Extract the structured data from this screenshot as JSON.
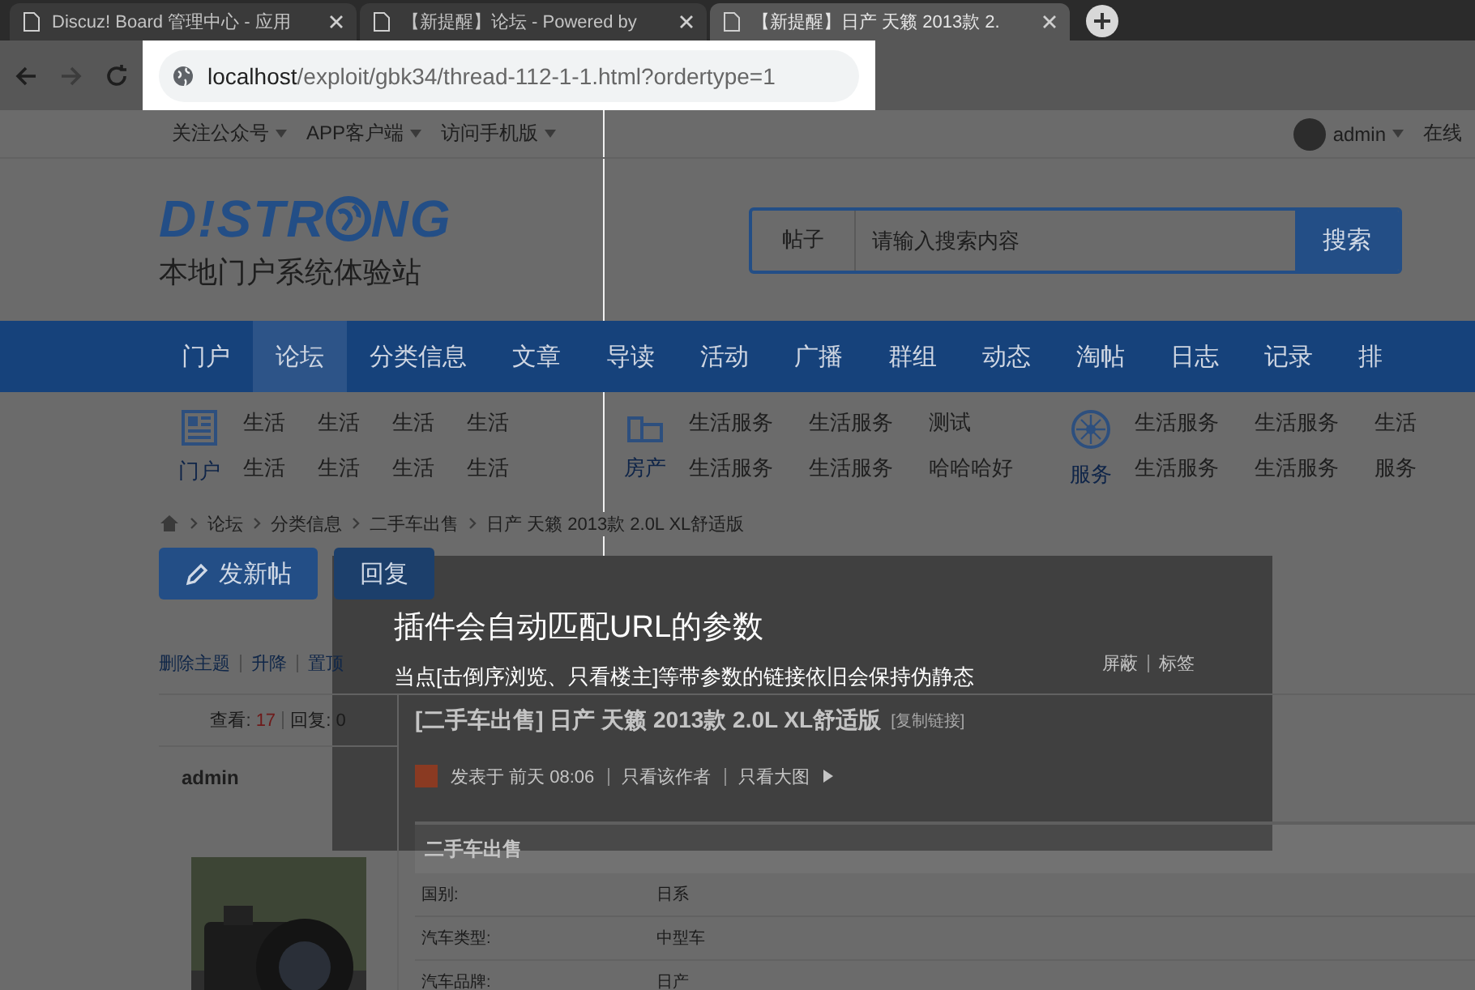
{
  "browser": {
    "tabs": [
      {
        "title": "Discuz! Board 管理中心 - 应用",
        "selected": false
      },
      {
        "title": "【新提醒】论坛 - Powered by",
        "selected": false
      },
      {
        "title": "【新提醒】日产 天籁 2013款 2.",
        "selected": true
      }
    ],
    "url": {
      "host": "localhost",
      "path": "/exploit/gbk34/thread-112-1-1.html?ordertype=1"
    }
  },
  "topbar": {
    "links": [
      "关注公众号",
      "APP客户端",
      "访问手机版"
    ],
    "user": "admin",
    "status": "在线"
  },
  "logo": {
    "before": "D!STR",
    "after": "NG",
    "subtitle": "本地门户系统体验站"
  },
  "search": {
    "scope": "帖子",
    "placeholder": "请输入搜索内容",
    "button": "搜索"
  },
  "nav": [
    {
      "label": "门户",
      "selected": false
    },
    {
      "label": "论坛",
      "selected": true
    },
    {
      "label": "分类信息",
      "selected": false
    },
    {
      "label": "文章",
      "selected": false
    },
    {
      "label": "导读",
      "selected": false
    },
    {
      "label": "活动",
      "selected": false
    },
    {
      "label": "广播",
      "selected": false
    },
    {
      "label": "群组",
      "selected": false
    },
    {
      "label": "动态",
      "selected": false
    },
    {
      "label": "淘帖",
      "selected": false
    },
    {
      "label": "日志",
      "selected": false
    },
    {
      "label": "记录",
      "selected": false
    },
    {
      "label": "排",
      "selected": false
    }
  ],
  "subnav": [
    {
      "kind": "newspaper",
      "label": "门户",
      "rows": [
        [
          "生活",
          "生活",
          "生活",
          "生活"
        ],
        [
          "生活",
          "生活",
          "生活",
          "生活"
        ]
      ]
    },
    {
      "kind": "building",
      "label": "房产",
      "rows": [
        [
          "生活服务",
          "生活服务",
          "测试"
        ],
        [
          "生活服务",
          "生活服务",
          "哈哈哈好"
        ]
      ]
    },
    {
      "kind": "flower",
      "label": "服务",
      "rows": [
        [
          "生活服务",
          "生活服务",
          "生活"
        ],
        [
          "生活服务",
          "生活服务",
          "服务"
        ]
      ]
    }
  ],
  "breadcrumb": [
    "论坛",
    "分类信息",
    "二手车出售",
    "日产 天籁 2013款 2.0L XL舒适版"
  ],
  "actions": [
    {
      "kind": "new",
      "label": "发新帖"
    },
    {
      "kind": "reply",
      "label": "回复"
    }
  ],
  "mod_tools": [
    "删除主题",
    "升降",
    "置顶",
    "屏蔽",
    "标签"
  ],
  "stats": {
    "views_label": "查看:",
    "views": "17",
    "replies_label": "回复:",
    "replies": "0"
  },
  "thread": {
    "title": "[二手车出售] 日产 天籁 2013款 2.0L XL舒适版",
    "copy_link": "[复制链接]"
  },
  "post": {
    "author": "admin",
    "meta": "发表于 前天 08:06",
    "links": [
      "只看该作者",
      "只看大图"
    ],
    "table": {
      "heading": "二手车出售",
      "rows": [
        [
          "国别:",
          "日系"
        ],
        [
          "汽车类型:",
          "中型车"
        ],
        [
          "汽车品牌:",
          "日产"
        ]
      ]
    }
  },
  "tooltip": {
    "title": "插件会自动匹配URL的参数",
    "body": "当点[击倒序浏览、只看楼主]等带参数的链接依旧会保持伪静态"
  }
}
